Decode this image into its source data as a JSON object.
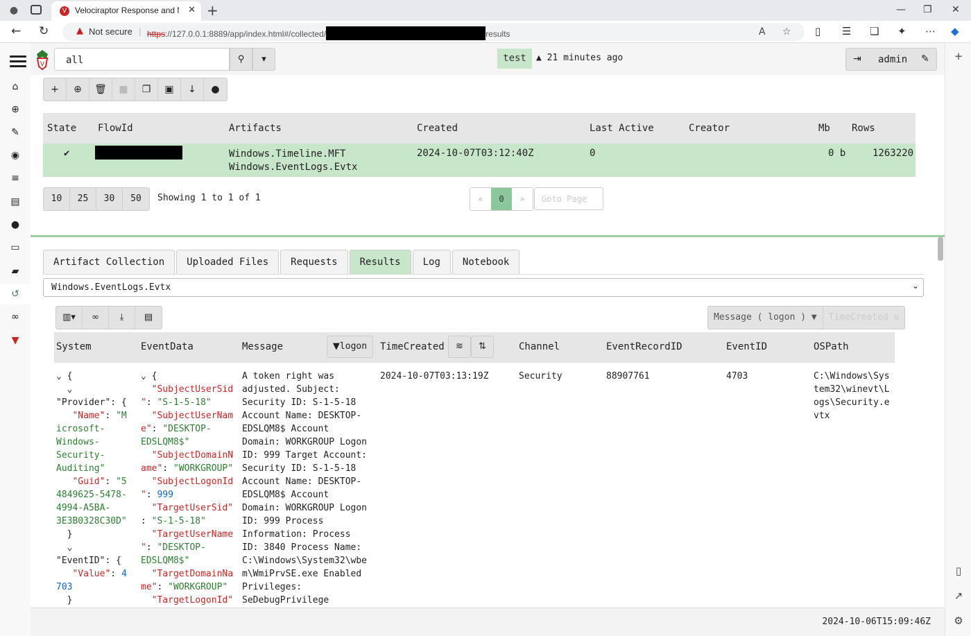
{
  "browser": {
    "tab_title": "Velociraptor Response and Moni",
    "not_secure": "Not secure",
    "url_protocol": "https",
    "url_prefix": "://127.0.0.1:8889/app/index.html#/collected/",
    "url_suffix": "results"
  },
  "app": {
    "search_value": "all",
    "client_name": "test",
    "client_status": "21 minutes ago",
    "username": "admin"
  },
  "flows": {
    "columns": [
      "State",
      "FlowId",
      "Artifacts",
      "Created",
      "Last Active",
      "Creator",
      "Mb",
      "Rows"
    ],
    "row": {
      "state": "✔",
      "artifacts_1": "Windows.Timeline.MFT",
      "artifacts_2": "Windows.EventLogs.Evtx",
      "created": "2024-10-07T03:12:40Z",
      "last_active": "0",
      "creator": "",
      "mb": "0 b",
      "rows": "1263220"
    }
  },
  "pager": {
    "sizes": [
      "10",
      "25",
      "30",
      "50"
    ],
    "showing": "Showing 1 to 1 of 1",
    "prev": "«",
    "current": "0",
    "next": "»",
    "goto_placeholder": "Goto Page"
  },
  "details": {
    "tabs": [
      "Artifact Collection",
      "Uploaded Files",
      "Requests",
      "Results",
      "Log",
      "Notebook"
    ],
    "active_tab": "Results",
    "artifact_selected": "Windows.EventLogs.Evtx",
    "filter_label": "Message ( logon )",
    "sort_label": "TimeCreated ⇅"
  },
  "results": {
    "columns": [
      "System",
      "EventData",
      "Message",
      "TimeCreated",
      "Channel",
      "EventRecordID",
      "EventID",
      "OSPath"
    ],
    "message_filter": "logon",
    "row": {
      "message": "A token right was\nadjusted. Subject:\nSecurity ID: S-1-5-18\nAccount Name: DESKTOP-\nEDSLQM8$ Account\nDomain: WORKGROUP Logon\nID: 999 Target Account:\nSecurity ID: S-1-5-18\nAccount Name: DESKTOP-\nEDSLQM8$ Account\nDomain: WORKGROUP Logon\nID: 999 Process\nInformation: Process\nID: 3840 Process Name:\nC:\\Windows\\System32\\wbe\nm\\WmiPrvSE.exe Enabled\nPrivileges:\nSeDebugPrivilege\nDisabled Privileges: -",
      "time_created": "2024-10-07T03:13:19Z",
      "channel": "Security",
      "event_record_id": "88907761",
      "event_id": "4703",
      "os_path": "C:\\Windows\\Sys\ntem32\\winevt\\L\nogs\\Security.e\nvtx"
    }
  },
  "footer": {
    "timestamp": "2024-10-06T15:09:46Z"
  }
}
